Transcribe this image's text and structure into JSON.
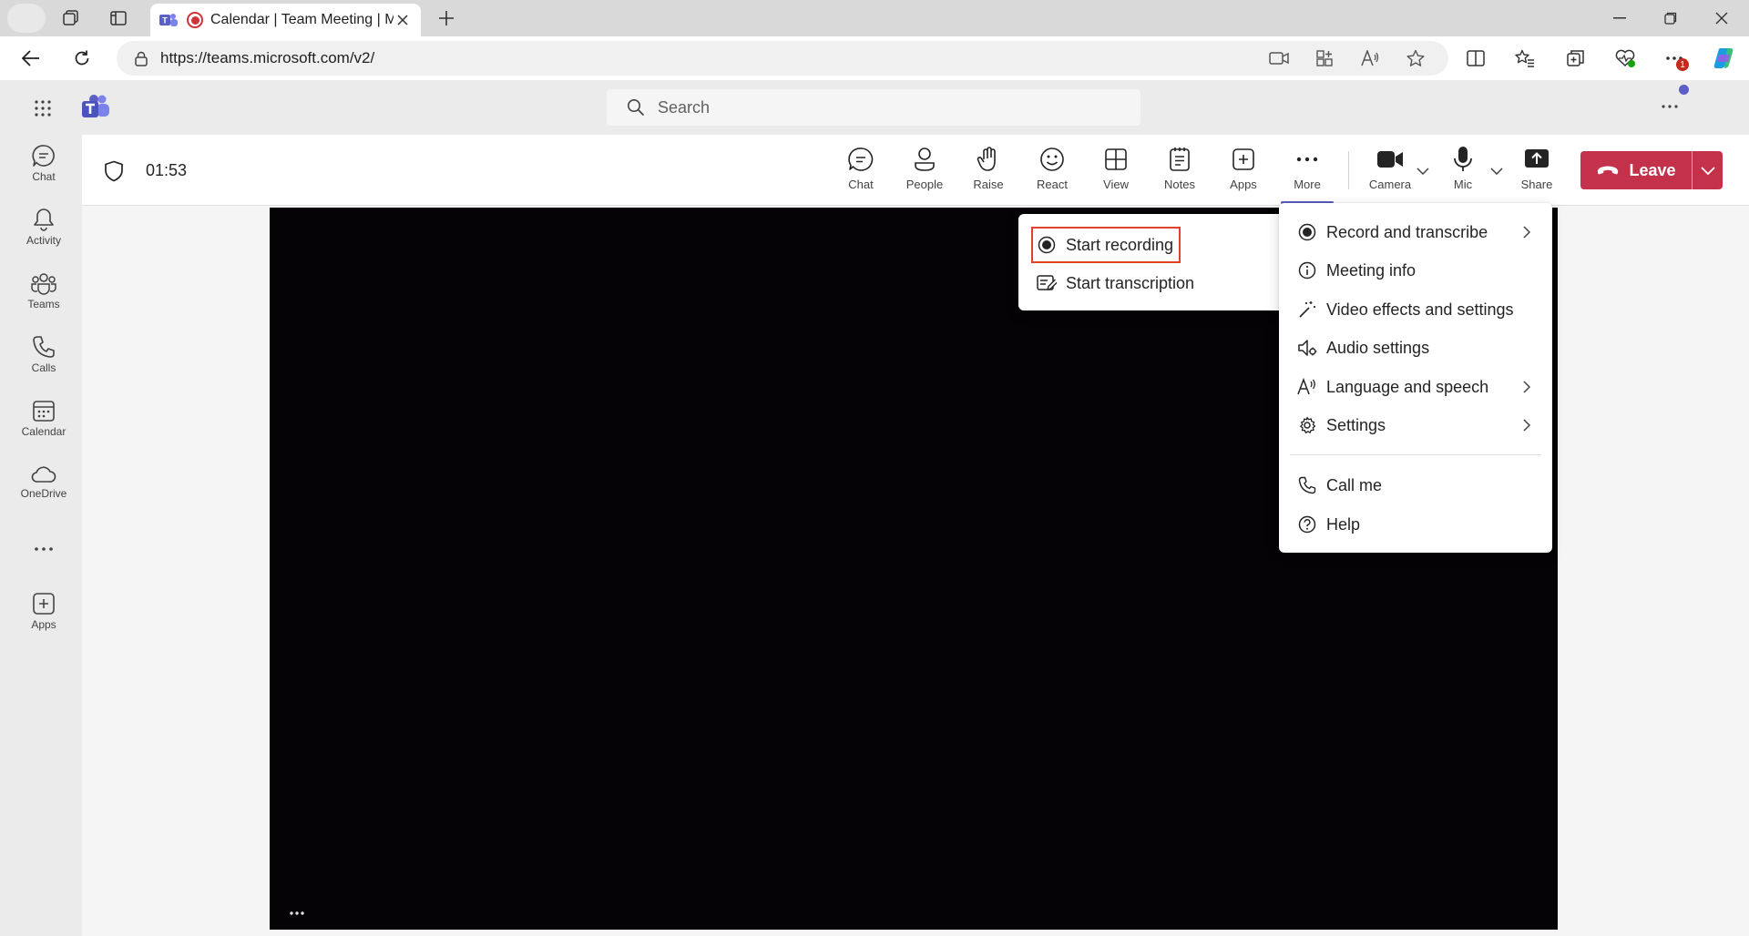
{
  "browser": {
    "tab_title": "Calendar | Team Meeting | Microsoft Teams",
    "url": "https://teams.microsoft.com/v2/",
    "badge_count": "1"
  },
  "app": {
    "search_placeholder": "Search"
  },
  "rail": {
    "items": [
      {
        "label": "Chat",
        "icon": "chat-icon"
      },
      {
        "label": "Activity",
        "icon": "bell-icon"
      },
      {
        "label": "Teams",
        "icon": "teams-icon"
      },
      {
        "label": "Calls",
        "icon": "phone-icon"
      },
      {
        "label": "Calendar",
        "icon": "calendar-icon"
      },
      {
        "label": "OneDrive",
        "icon": "cloud-icon"
      },
      {
        "label": "Apps",
        "icon": "add-app-icon"
      }
    ]
  },
  "meeting": {
    "timer": "01:53",
    "toolbar": {
      "chat": "Chat",
      "people": "People",
      "raise": "Raise",
      "react": "React",
      "view": "View",
      "notes": "Notes",
      "apps": "Apps",
      "more": "More",
      "camera": "Camera",
      "mic": "Mic",
      "share": "Share",
      "leave": "Leave"
    },
    "leave_color": "#c4314b",
    "accent_color": "#5b5fc7"
  },
  "more_menu": {
    "items": [
      {
        "label": "Record and transcribe",
        "icon": "record-icon",
        "submenu": true
      },
      {
        "label": "Meeting info",
        "icon": "info-icon",
        "submenu": false
      },
      {
        "label": "Video effects and settings",
        "icon": "magic-wand-icon",
        "submenu": false
      },
      {
        "label": "Audio settings",
        "icon": "speaker-settings-icon",
        "submenu": false
      },
      {
        "label": "Language and speech",
        "icon": "language-icon",
        "submenu": true
      },
      {
        "label": "Settings",
        "icon": "gear-icon",
        "submenu": true
      },
      {
        "label": "Call me",
        "icon": "phone-icon",
        "submenu": false
      },
      {
        "label": "Help",
        "icon": "help-icon",
        "submenu": false
      }
    ]
  },
  "record_submenu": {
    "start_recording": "Start recording",
    "start_transcription": "Start transcription",
    "highlight_color": "#e1412b"
  }
}
